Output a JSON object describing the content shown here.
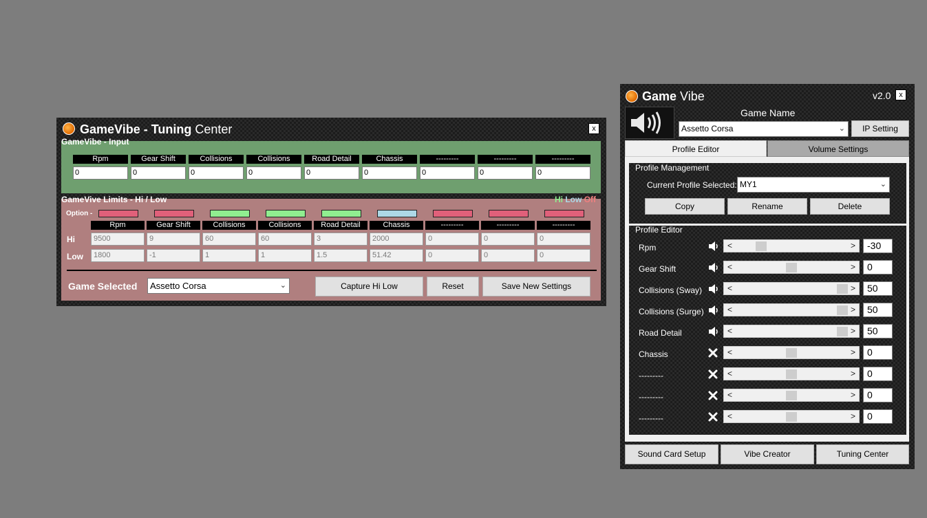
{
  "tuning": {
    "title_bold1": "GameVibe",
    "title_sep": " - ",
    "title_bold2": "Tuning",
    "title_light": " Center",
    "close_label": "x",
    "input_section_label": "GameVibe - Input",
    "input_headers": [
      "Rpm",
      "Gear Shift",
      "Collisions",
      "Collisions",
      "Road Detail",
      "Chassis",
      "---------",
      "---------",
      "---------"
    ],
    "input_values": [
      "0",
      "0",
      "0",
      "0",
      "0",
      "0",
      "0",
      "0",
      "0"
    ],
    "limits_section_label": "GameVive Limits - Hi / Low",
    "legend_hi": "Hi",
    "legend_low": "Low",
    "legend_off": "Off",
    "option_label": "Option -",
    "option_colors": [
      "#e0607a",
      "#e0607a",
      "#90ee90",
      "#90ee90",
      "#90ee90",
      "#add8e6",
      "#e0607a",
      "#e0607a",
      "#e0607a"
    ],
    "limit_headers": [
      "Rpm",
      "Gear Shift",
      "Collisions",
      "Collisions",
      "Road Detail",
      "Chassis",
      "---------",
      "---------",
      "---------"
    ],
    "hi_label": "Hi",
    "low_label": "Low",
    "hi_values": [
      "9500",
      "9",
      "60",
      "60",
      "3",
      "2000",
      "0",
      "0",
      "0"
    ],
    "low_values": [
      "1800",
      "-1",
      "1",
      "1",
      "1.5",
      "51.42",
      "0",
      "0",
      "0"
    ],
    "game_selected_label": "Game Selected",
    "game_selected_value": "Assetto Corsa",
    "capture_label": "Capture Hi Low",
    "reset_label": "Reset",
    "save_label": "Save New Settings"
  },
  "vibe": {
    "title_bold": "Game",
    "title_light": " Vibe",
    "version": "v2.0",
    "close_label": "x",
    "game_name_label": "Game Name",
    "game_value": "Assetto Corsa",
    "ip_setting_label": "IP Setting",
    "tabs": [
      "Profile Editor",
      "Volume Settings"
    ],
    "profile_management_label": "Profile Management",
    "current_profile_label": "Current Profile Selected:",
    "current_profile_value": "MY1",
    "copy_label": "Copy",
    "rename_label": "Rename",
    "delete_label": "Delete",
    "profile_editor_label": "Profile Editor",
    "rows": [
      {
        "label": "Rpm",
        "icon": "speaker-icon",
        "value": "-30",
        "level": 0.2
      },
      {
        "label": "Gear Shift",
        "icon": "speaker-icon",
        "value": "0",
        "level": 0.5
      },
      {
        "label": "Collisions (Sway)",
        "icon": "speaker-icon",
        "value": "50",
        "level": 1.0
      },
      {
        "label": "Collisions (Surge)",
        "icon": "speaker-icon",
        "value": "50",
        "level": 1.0
      },
      {
        "label": "Road Detail",
        "icon": "speaker-icon",
        "value": "50",
        "level": 1.0
      },
      {
        "label": "Chassis",
        "icon": "mute-x-icon",
        "value": "0",
        "level": 0.5
      },
      {
        "label": "---------",
        "icon": "mute-x-icon",
        "value": "0",
        "level": 0.5
      },
      {
        "label": "---------",
        "icon": "mute-x-icon",
        "value": "0",
        "level": 0.5
      },
      {
        "label": "---------",
        "icon": "mute-x-icon",
        "value": "0",
        "level": 0.5
      }
    ],
    "bottom_buttons": [
      "Sound Card Setup",
      "Vibe Creator",
      "Tuning Center"
    ]
  }
}
